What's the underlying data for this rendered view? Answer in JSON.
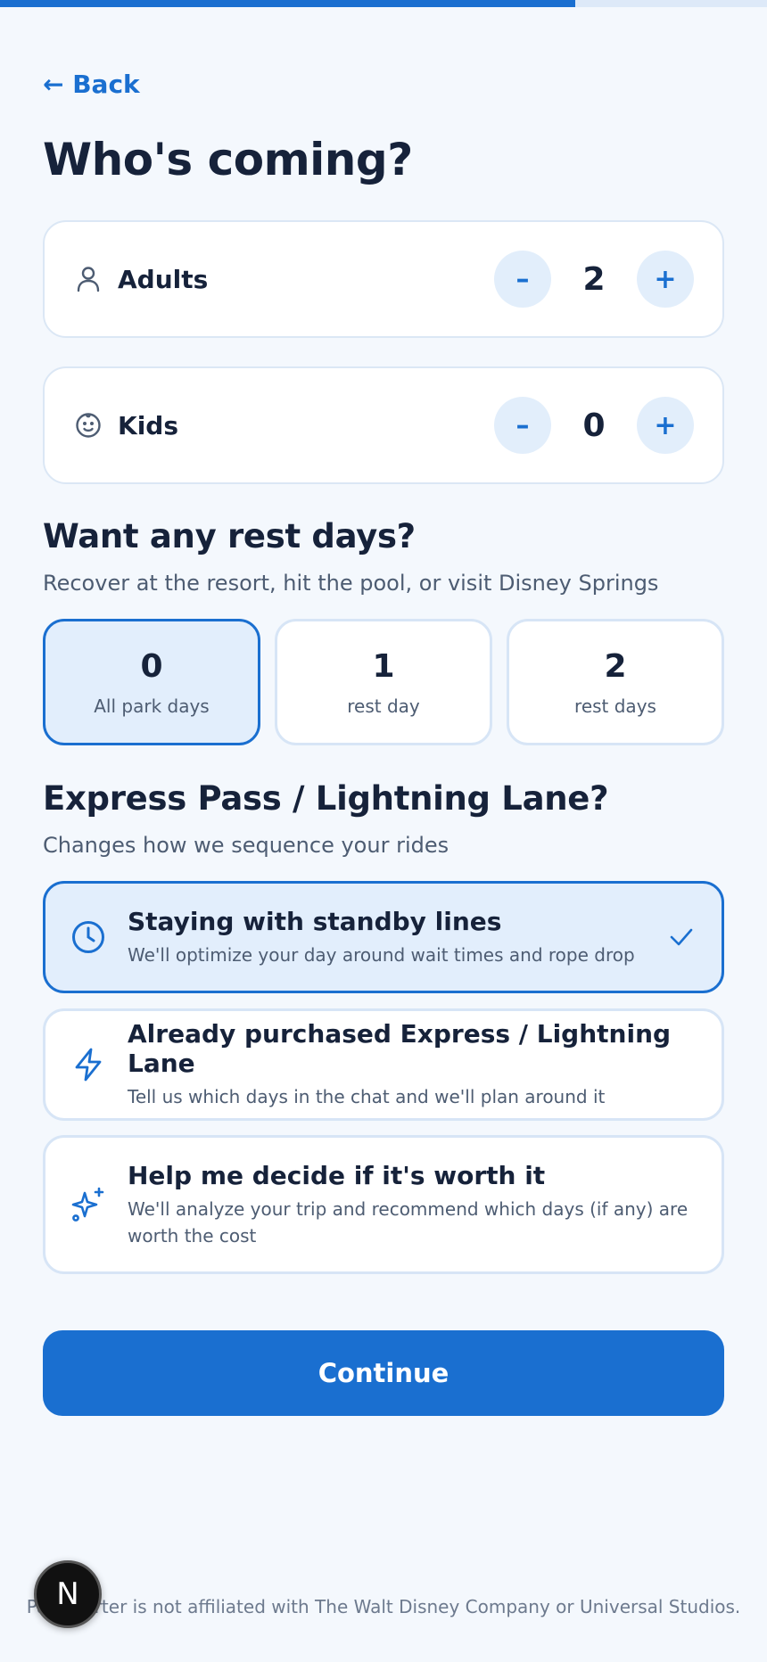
{
  "progress": {
    "value": 0.75
  },
  "nav": {
    "back_label": "← Back"
  },
  "guests": {
    "title": "Who's coming?",
    "adults": {
      "label": "Adults",
      "value": "2",
      "decrement": "–",
      "increment": "+"
    },
    "kids": {
      "label": "Kids",
      "value": "0",
      "decrement": "–",
      "increment": "+"
    }
  },
  "rest": {
    "title": "Want any rest days?",
    "subtitle": "Recover at the resort, hit the pool, or visit Disney Springs",
    "options": [
      {
        "num": "0",
        "label": "All park days",
        "selected": true
      },
      {
        "num": "1",
        "label": "rest day",
        "selected": false
      },
      {
        "num": "2",
        "label": "rest days",
        "selected": false
      }
    ]
  },
  "express": {
    "title": "Express Pass / Lightning Lane?",
    "subtitle": "Changes how we sequence your rides",
    "options": [
      {
        "icon": "clock-icon",
        "title": "Staying with standby lines",
        "desc": "We'll optimize your day around wait times and rope drop",
        "selected": true
      },
      {
        "icon": "lightning-icon",
        "title": "Already purchased Express / Lightning Lane",
        "desc": "Tell us which days in the chat and we'll plan around it",
        "selected": false
      },
      {
        "icon": "sparkles-icon",
        "title": "Help me decide if it's worth it",
        "desc": "We'll analyze your trip and recommend which days (if any) are worth the cost",
        "selected": false
      }
    ]
  },
  "continue_label": "Continue",
  "footer": {
    "text": "ParkStarter is not affiliated with The Walt Disney Company or Universal Studios."
  },
  "dev_badge": {
    "label": "N"
  },
  "colors": {
    "accent": "#1a6fd0",
    "selected_bg": "#e2eefc",
    "background": "#f4f8fd"
  }
}
